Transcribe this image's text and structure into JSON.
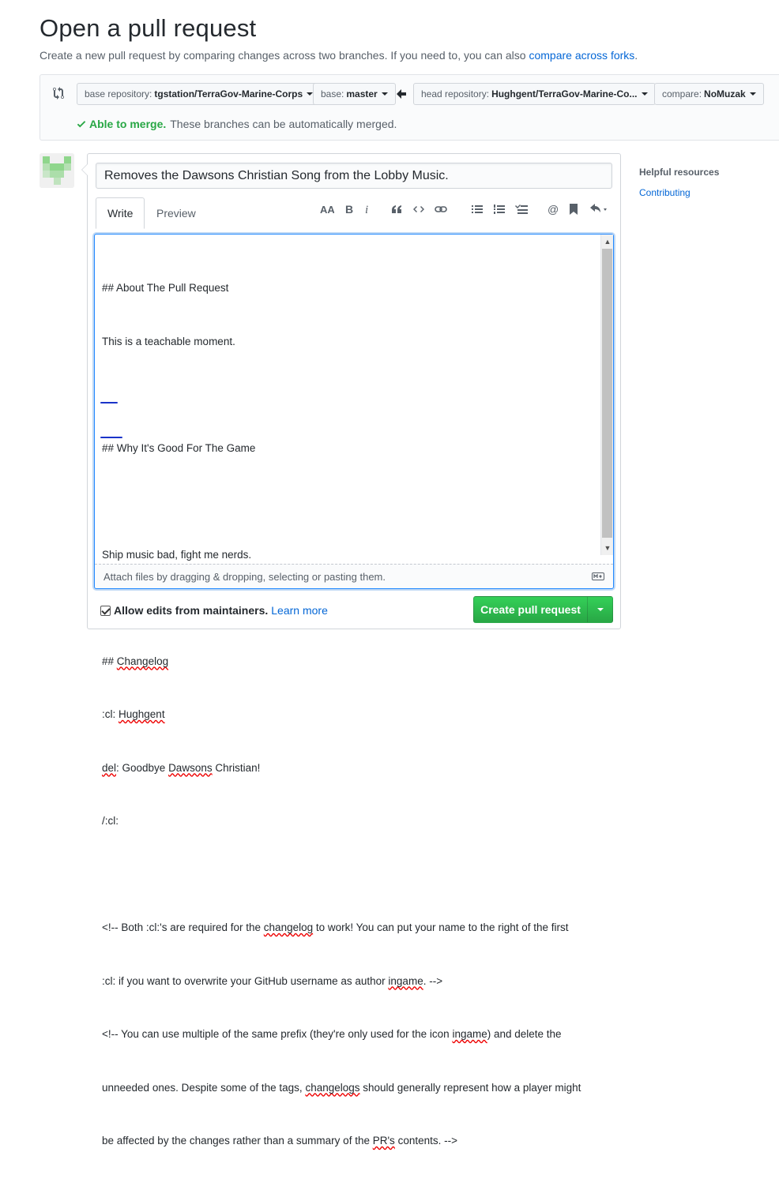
{
  "header": {
    "title": "Open a pull request",
    "subtitle": "Create a new pull request by comparing changes across two branches. If you need to, you can also",
    "subtitle_link": "compare across forks",
    "subtitle_end": "."
  },
  "compare": {
    "base_repo_label": "base repository:",
    "base_repo_value": "tgstation/TerraGov-Marine-Corps",
    "base_label": "base:",
    "base_value": "master",
    "head_repo_label": "head repository:",
    "head_repo_value": "Hughgent/TerraGov-Marine-Co...",
    "compare_label": "compare:",
    "compare_value": "NoMuzak",
    "merge_ok": "Able to merge.",
    "merge_msg": "These branches can be automatically merged."
  },
  "form": {
    "title_value": "Removes the Dawsons Christian Song from the Lobby Music.",
    "tab_write": "Write",
    "tab_preview": "Preview",
    "toolbar_icons": [
      "text-size-icon",
      "bold-icon",
      "italic-icon",
      "quote-icon",
      "code-icon",
      "link-icon",
      "bullet-list-icon",
      "numbered-list-icon",
      "task-list-icon",
      "mention-icon",
      "bookmark-icon",
      "reply-icon"
    ],
    "body": {
      "l1": "## About The Pull Request",
      "l2": "This is a teachable moment.",
      "l3": "## Why It's Good For The Game",
      "l4": "Ship music bad, fight me nerds.",
      "l5a": "## ",
      "l5b": "Changelog",
      "l6a": ":cl: ",
      "l6b": "Hughgent",
      "l7a": "del",
      "l7b": ": Goodbye ",
      "l7c": "Dawsons",
      "l7d": " Christian!",
      "l8": "/:cl:",
      "l9a": "<!-- Both :cl:'s are required for the ",
      "l9b": "changelog",
      "l9c": " to work! You can put your name to the right of the first",
      "l10a": ":cl: if you want to overwrite your GitHub username as author ",
      "l10b": "ingame",
      "l10c": ". -->",
      "l11a": "<!-- You can use multiple of the same prefix (they're only used for the icon ",
      "l11b": "ingame",
      "l11c": ") and delete the",
      "l12a": "unneeded ones. Despite some of the tags, ",
      "l12b": "changelogs",
      "l12c": " should generally represent how a player might",
      "l13a": "be affected by the changes rather than a summary of the ",
      "l13b": "PR's",
      "l13c": " contents. -->"
    },
    "dropzone": "Attach files by dragging & dropping, selecting or pasting them.",
    "allow_edits": "Allow edits from maintainers.",
    "learn_more": "Learn more",
    "create_button": "Create pull request"
  },
  "sidebar": {
    "heading": "Helpful resources",
    "link": "Contributing"
  },
  "colors": {
    "primary_green": "#28a745",
    "link_blue": "#0366d6",
    "text": "#24292e",
    "muted": "#586069"
  }
}
